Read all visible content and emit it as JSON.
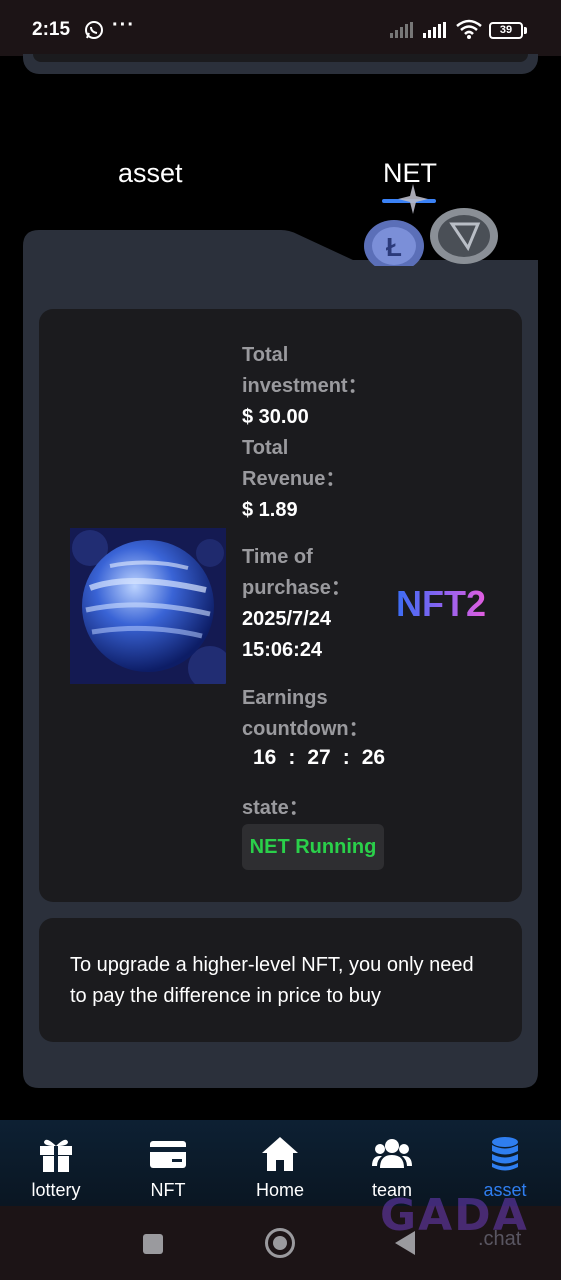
{
  "status_bar": {
    "time": "2:15",
    "more": "···",
    "battery": "39"
  },
  "tabs": [
    {
      "label": "asset",
      "active": false
    },
    {
      "label": "NET",
      "active": true
    }
  ],
  "nft_card": {
    "total_investment_label": [
      "Total",
      "investment："
    ],
    "total_investment_value": "$ 30.00",
    "total_revenue_label": [
      "Total",
      "Revenue："
    ],
    "total_revenue_value": "$ 1.89",
    "time_of_purchase_label": [
      "Time of",
      "purchase："
    ],
    "time_of_purchase_value": [
      "2025/7/24",
      "15:06:24"
    ],
    "earnings_countdown_label": [
      "Earnings",
      "countdown："
    ],
    "countdown": {
      "hours": "16",
      "minutes": "27",
      "seconds": "26",
      "separator": ":"
    },
    "state_label": "state：",
    "state_value": "NET Running",
    "nft_name": "NFT2"
  },
  "note": {
    "text": "To upgrade a higher-level NFT, you only need to pay the difference in price to buy"
  },
  "bottom_nav": [
    {
      "label": "lottery",
      "icon": "gift-icon",
      "active": false
    },
    {
      "label": "NFT",
      "icon": "card-icon",
      "active": false
    },
    {
      "label": "Home",
      "icon": "home-icon",
      "active": false
    },
    {
      "label": "team",
      "icon": "team-icon",
      "active": false
    },
    {
      "label": "asset",
      "icon": "database-icon",
      "active": true
    }
  ],
  "watermark": {
    "brand": "GADA",
    "sub": ".chat"
  },
  "colors": {
    "accent_blue": "#2f7ef0",
    "running_green": "#2ad04a",
    "panel": "#2b303b",
    "card": "#1b1b1e"
  }
}
